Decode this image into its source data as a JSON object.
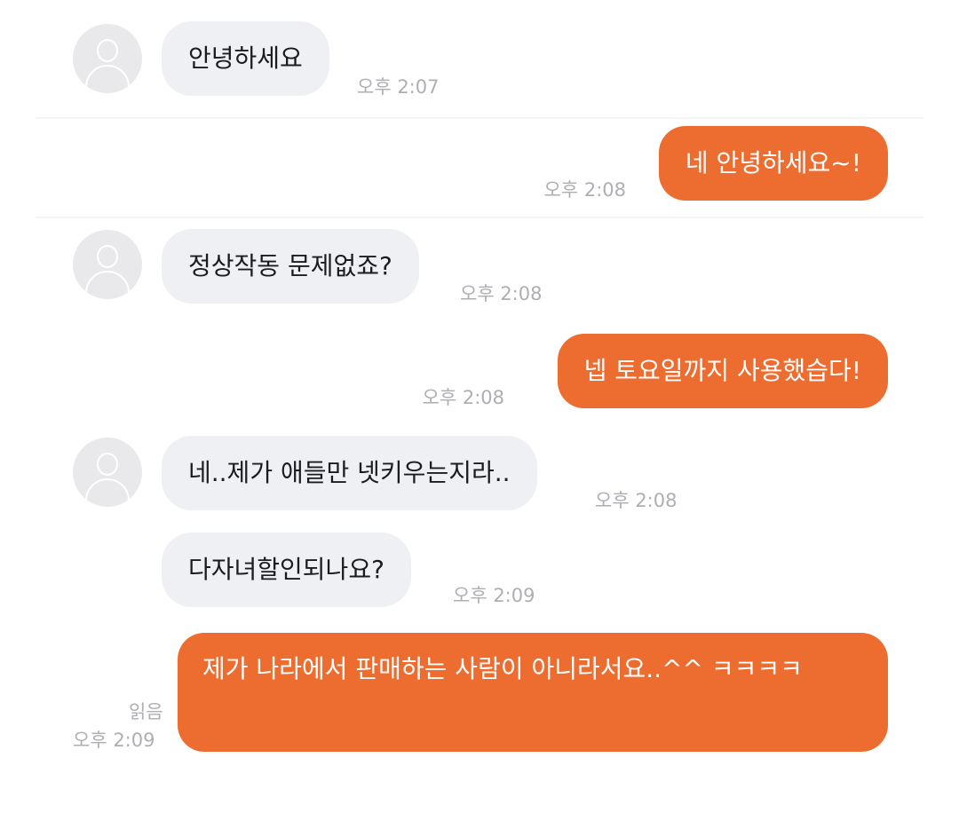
{
  "messages": [
    {
      "text": "안녕하세요",
      "time": "오후 2:07"
    },
    {
      "text": "네 안녕하세요~!",
      "time": "오후 2:08"
    },
    {
      "text": "정상작동 문제없죠?",
      "time": "오후 2:08"
    },
    {
      "text": "넵 토요일까지 사용했습다!",
      "time": "오후 2:08"
    },
    {
      "text": "네..제가 애들만 넷키우는지라..",
      "time": "오후 2:08"
    },
    {
      "text": "다자녀할인되나요?",
      "time": "오후 2:09"
    },
    {
      "text": "제가 나라에서 판매하는 사람이 아니라서요..^^ ㅋㅋㅋㅋ",
      "time": "오후 2:09",
      "status": "읽음"
    }
  ],
  "colors": {
    "outgoing_bubble": "#ec6d2f",
    "incoming_bubble": "#eff0f4",
    "timestamp": "#aeaeb4"
  },
  "icons": {
    "avatar": "default-profile-icon"
  }
}
